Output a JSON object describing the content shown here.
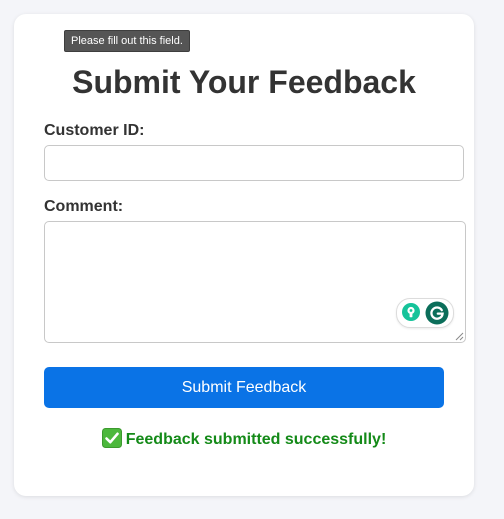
{
  "tooltip": {
    "text": "Please fill out this field."
  },
  "form": {
    "title": "Submit Your Feedback",
    "customer_id": {
      "label": "Customer ID:",
      "value": "",
      "placeholder": ""
    },
    "comment": {
      "label": "Comment:",
      "value": "",
      "placeholder": ""
    },
    "submit_label": "Submit Feedback"
  },
  "status": {
    "icon": "check-mark-icon",
    "message": "Feedback submitted successfully!"
  },
  "grammarly": {
    "icons": [
      "lightbulb-icon",
      "grammarly-logo-icon"
    ]
  },
  "colors": {
    "primary_button": "#0a73e6",
    "success_text": "#148a18",
    "heading_text": "#333333",
    "page_background": "#f4f5f9"
  }
}
